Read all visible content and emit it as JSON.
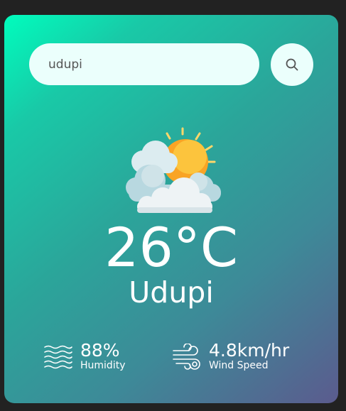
{
  "search": {
    "value": "udupi",
    "placeholder": ""
  },
  "weather": {
    "icon": "sun-behind-clouds-icon",
    "temperature": "26°C",
    "city": "Udupi"
  },
  "humidity": {
    "value": "88%",
    "label": "Humidity",
    "icon": "humidity-waves-icon"
  },
  "wind": {
    "value": "4.8km/hr",
    "label": "Wind Speed",
    "icon": "wind-icon"
  },
  "colors": {
    "background": "#222222",
    "card_gradient_start": "#00fdbd",
    "card_gradient_end": "#5b5b8e",
    "input_bg": "#ebfffc",
    "text": "#ffffff"
  }
}
